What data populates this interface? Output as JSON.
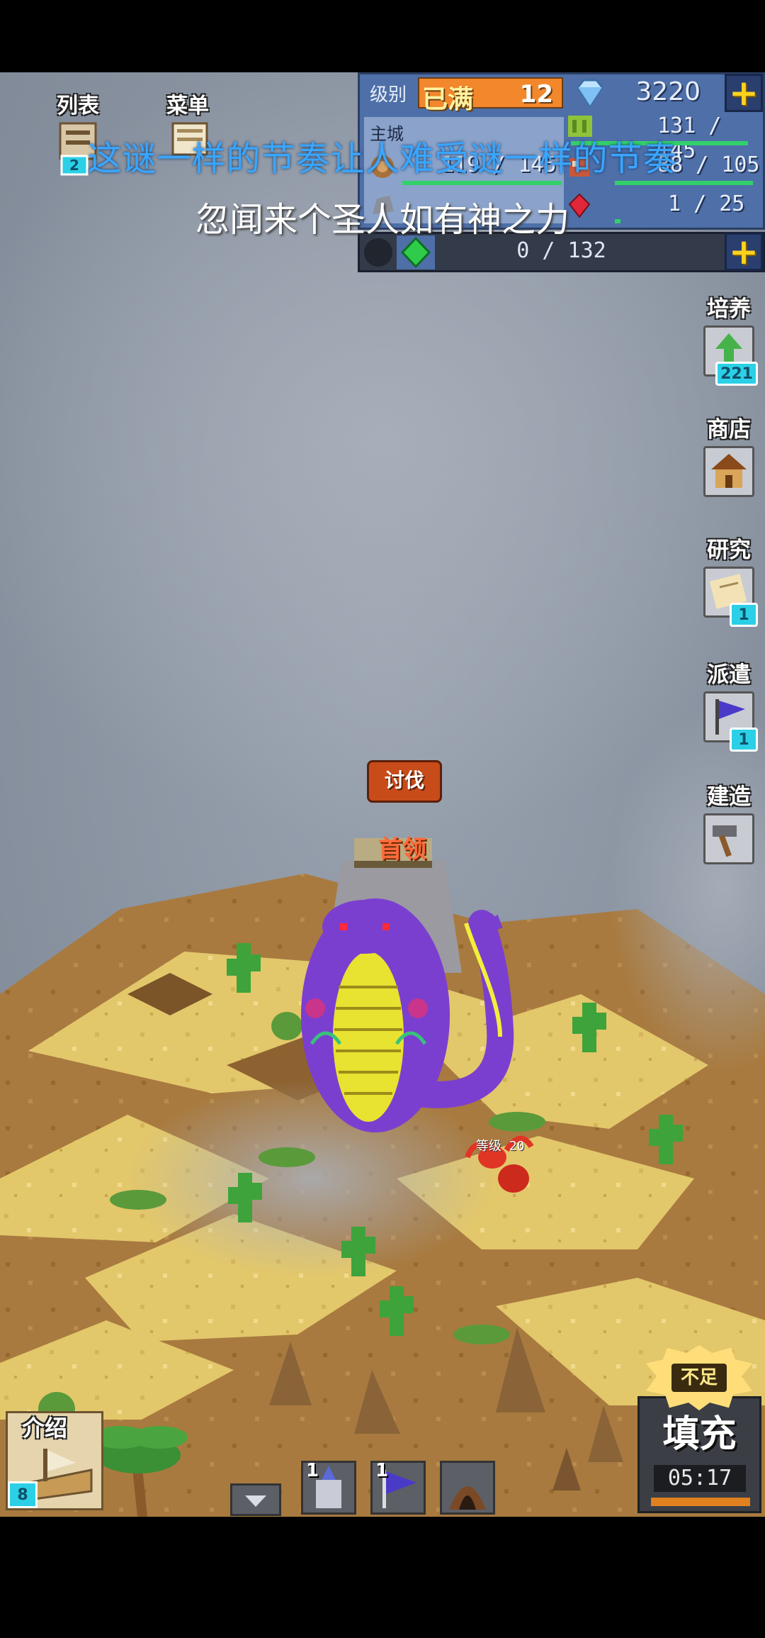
{
  "hud": {
    "level_label": "级别",
    "level_status": "已满",
    "level_value": "12",
    "gems": "3220",
    "city_label": "主城",
    "resource_1": "131 / 145",
    "resource_2": "119 / 145",
    "resource_3": "88 / 105",
    "resource_4": "1 / 25",
    "exp": "0 / 132",
    "add_symbol": "+"
  },
  "subtitles": {
    "line1": "这谜一样的节奏让人难受谜一样的节奏",
    "line2": "忽闻来个圣人如有神之力"
  },
  "top_left": {
    "list_label": "列表",
    "menu_label": "菜单",
    "list_badge": "2"
  },
  "side_menu": [
    {
      "label": "培养",
      "badge": "221",
      "icon": "train-icon"
    },
    {
      "label": "商店",
      "badge": "",
      "icon": "shop-icon"
    },
    {
      "label": "研究",
      "badge": "1",
      "icon": "research-icon"
    },
    {
      "label": "派遣",
      "badge": "1",
      "icon": "flag-icon"
    },
    {
      "label": "建造",
      "badge": "",
      "icon": "hammer-icon"
    }
  ],
  "map": {
    "attack_label": "讨伐",
    "boss_label": "首领",
    "enemy_level": "等级 20"
  },
  "bottom": {
    "intro_label": "介绍",
    "intro_badge": "8",
    "castle_count": "1",
    "flag_count": "1",
    "refill_tag": "不足",
    "refill_label": "填充",
    "refill_timer": "05:17"
  },
  "colors": {
    "boss_purple": "#7b3fd0",
    "sand": "#e7cf7a",
    "fog": "#8d97a4",
    "accent_blue": "#4e6fa8"
  }
}
